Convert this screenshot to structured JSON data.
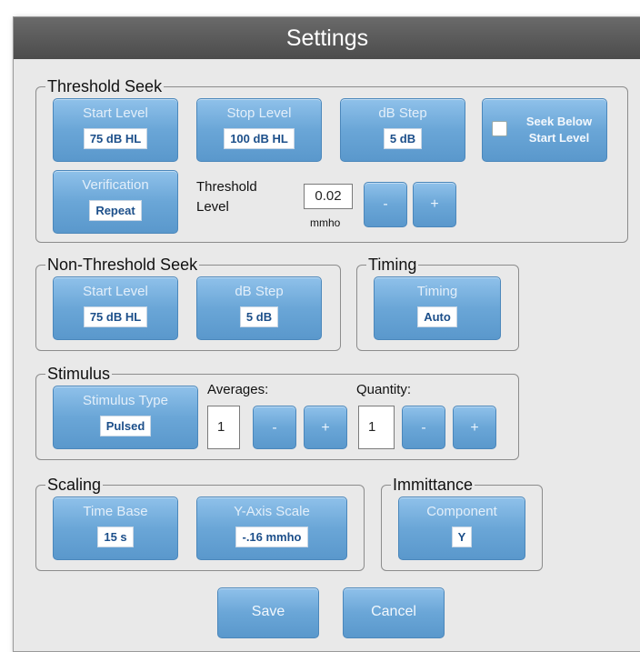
{
  "title": "Settings",
  "threshold_seek": {
    "legend": "Threshold Seek",
    "start_level": {
      "label": "Start Level",
      "value": "75 dB HL"
    },
    "stop_level": {
      "label": "Stop Level",
      "value": "100 dB HL"
    },
    "db_step": {
      "label": "dB Step",
      "value": "5 dB"
    },
    "seek_below": {
      "line1": "Seek Below",
      "line2": "Start Level",
      "checked": false
    },
    "verification": {
      "label": "Verification",
      "value": "Repeat"
    },
    "threshold_level": {
      "line1": "Threshold",
      "line2": "Level",
      "value": "0.02",
      "unit": "mmho",
      "minus": "-",
      "plus": "+"
    }
  },
  "non_threshold_seek": {
    "legend": "Non-Threshold Seek",
    "start_level": {
      "label": "Start Level",
      "value": "75 dB HL"
    },
    "db_step": {
      "label": "dB Step",
      "value": "5 dB"
    }
  },
  "timing": {
    "legend": "Timing",
    "timing": {
      "label": "Timing",
      "value": "Auto"
    }
  },
  "stimulus": {
    "legend": "Stimulus",
    "type": {
      "label": "Stimulus Type",
      "value": "Pulsed"
    },
    "averages": {
      "label": "Averages:",
      "value": "1",
      "minus": "-",
      "plus": "+"
    },
    "quantity": {
      "label": "Quantity:",
      "value": "1",
      "minus": "-",
      "plus": "+"
    }
  },
  "scaling": {
    "legend": "Scaling",
    "time_base": {
      "label": "Time Base",
      "value": "15 s"
    },
    "y_axis": {
      "label": "Y-Axis Scale",
      "value": "-.16 mmho"
    }
  },
  "immittance": {
    "legend": "Immittance",
    "component": {
      "label": "Component",
      "value": "Y"
    }
  },
  "actions": {
    "save": "Save",
    "cancel": "Cancel"
  },
  "colors": {
    "button": "#6aa6d7",
    "titlebar": "#555555",
    "background": "#e9e9e9"
  }
}
